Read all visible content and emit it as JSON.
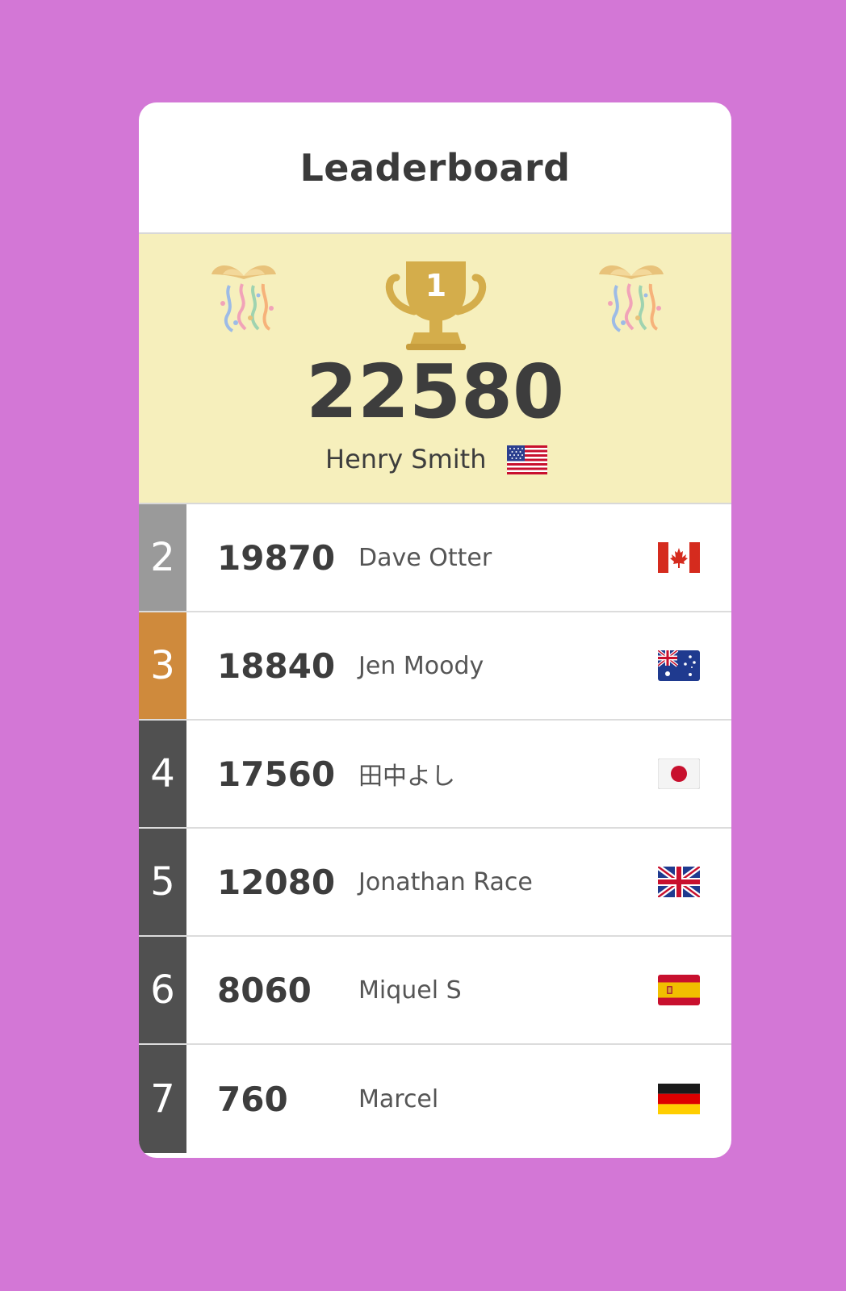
{
  "colors": {
    "background": "#d377d6",
    "card": "#ffffff",
    "winner_bg": "#f6efbc",
    "trophy": "#d4ad4b",
    "rank2": "#9a9a9a",
    "rank3": "#cf8a3c",
    "rank_other": "#505050",
    "text": "#3d3d3d"
  },
  "header": {
    "title": "Leaderboard"
  },
  "winner": {
    "rank": "1",
    "score": "22580",
    "name": "Henry Smith",
    "flag": "us-flag-icon"
  },
  "rows": [
    {
      "rank": "2",
      "score": "19870",
      "name": "Dave Otter",
      "flag": "canada-flag-icon"
    },
    {
      "rank": "3",
      "score": "18840",
      "name": "Jen Moody",
      "flag": "australia-flag-icon"
    },
    {
      "rank": "4",
      "score": "17560",
      "name": "田中よし",
      "flag": "japan-flag-icon"
    },
    {
      "rank": "5",
      "score": "12080",
      "name": "Jonathan Race",
      "flag": "uk-flag-icon"
    },
    {
      "rank": "6",
      "score": "8060",
      "name": "Miquel S",
      "flag": "spain-flag-icon"
    },
    {
      "rank": "7",
      "score": "760",
      "name": "Marcel",
      "flag": "germany-flag-icon"
    }
  ]
}
